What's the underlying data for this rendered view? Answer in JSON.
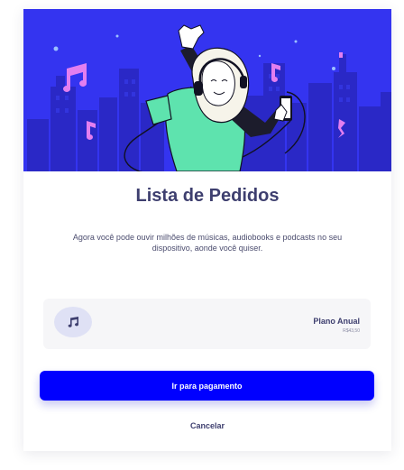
{
  "modal": {
    "title": "Lista de Pedidos",
    "description": "Agora você pode ouvir milhões de músicas, audiobooks e podcasts no seu dispositivo, aonde você quiser."
  },
  "plan": {
    "name": "Plano Anual",
    "price": "R$43,50",
    "icon": "music-note-icon"
  },
  "actions": {
    "pay_label": "Ir para pagamento",
    "cancel_label": "Cancelar"
  },
  "colors": {
    "accent": "#0000ff",
    "hero_background": "#3434f0",
    "heading": "#3e3f6f",
    "note_pink": "#e37ff0",
    "shirt_green": "#5ee3ae"
  }
}
